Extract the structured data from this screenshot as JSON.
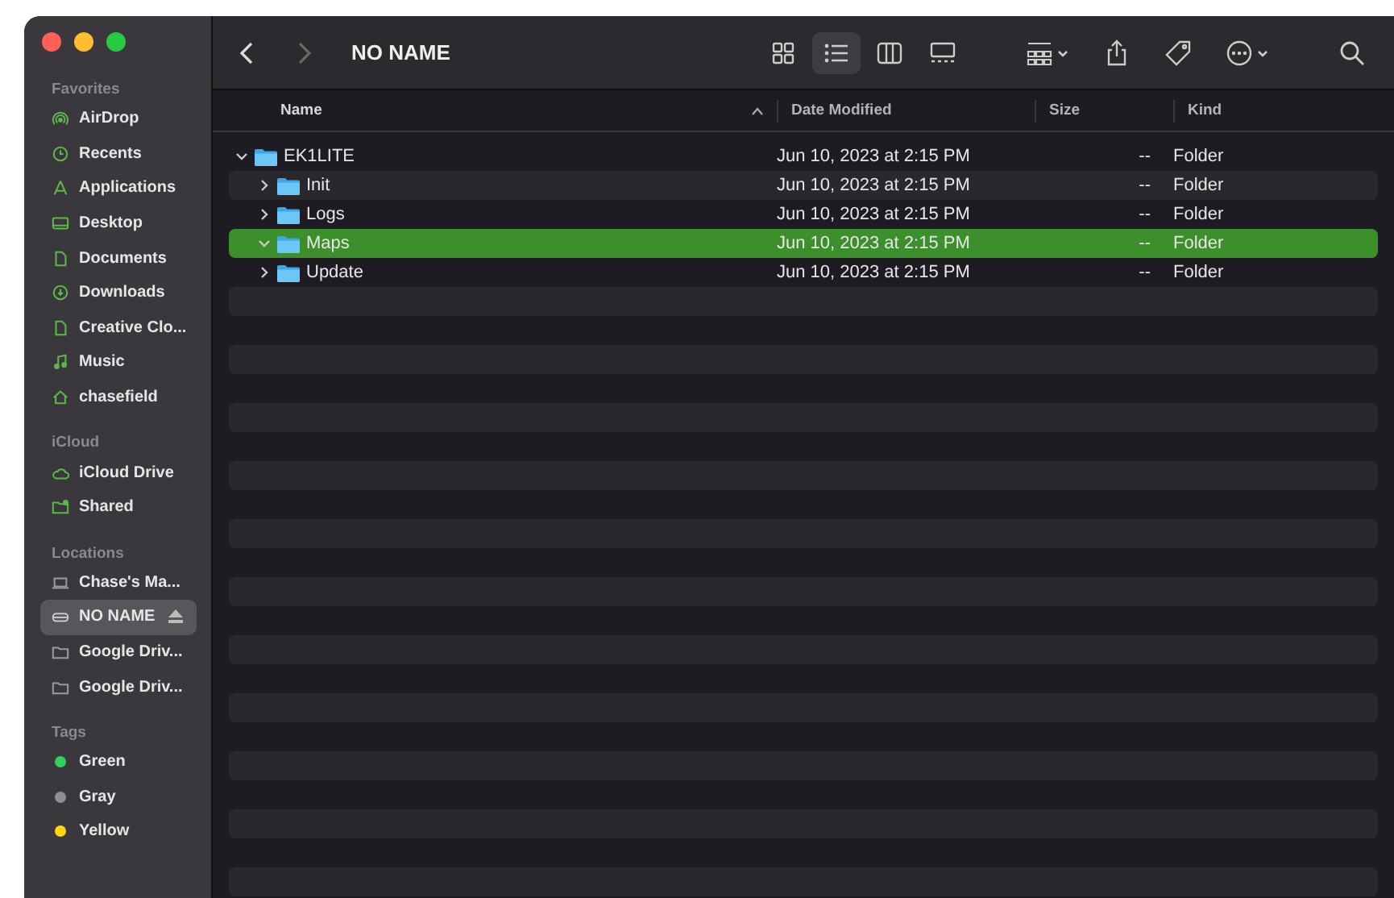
{
  "window": {
    "title": "NO NAME"
  },
  "navigation": {
    "back_enabled": true,
    "forward_enabled": false
  },
  "view_modes": [
    {
      "selected": false
    },
    {
      "selected": true
    },
    {
      "selected": false
    },
    {
      "selected": false
    }
  ],
  "sidebar": {
    "sections": [
      {
        "title": "Favorites",
        "items": [
          {
            "label": "AirDrop",
            "selected": false
          },
          {
            "label": "Recents",
            "selected": false
          },
          {
            "label": "Applications",
            "selected": false
          },
          {
            "label": "Desktop",
            "selected": false
          },
          {
            "label": "Documents",
            "selected": false
          },
          {
            "label": "Downloads",
            "selected": false
          },
          {
            "label": "Creative Clo...",
            "selected": false
          },
          {
            "label": "Music",
            "selected": false
          },
          {
            "label": "chasefield",
            "selected": false
          }
        ]
      },
      {
        "title": "iCloud",
        "items": [
          {
            "label": "iCloud Drive",
            "selected": false
          },
          {
            "label": "Shared",
            "selected": false
          }
        ]
      },
      {
        "title": "Locations",
        "items": [
          {
            "label": "Chase's Ma...",
            "selected": false
          },
          {
            "label": "NO NAME",
            "selected": true,
            "ejectable": true
          },
          {
            "label": "Google Driv...",
            "selected": false
          },
          {
            "label": "Google Driv...",
            "selected": false
          }
        ]
      },
      {
        "title": "Tags",
        "items": [
          {
            "label": "Green",
            "selected": false,
            "color": "#30d158"
          },
          {
            "label": "Gray",
            "selected": false,
            "color": "#8e8e93"
          },
          {
            "label": "Yellow",
            "selected": false,
            "color": "#ffd60a"
          }
        ]
      }
    ]
  },
  "table": {
    "columns": [
      {
        "label": "Name",
        "sorted": true
      },
      {
        "label": "Date Modified",
        "sorted": false
      },
      {
        "label": "Size",
        "sorted": false
      },
      {
        "label": "Kind",
        "sorted": false
      }
    ],
    "rows": [
      {
        "name": "EK1LITE",
        "date": "Jun 10, 2023 at 2:15 PM",
        "size": "--",
        "kind": "Folder",
        "expanded": true,
        "selected": false,
        "children": [
          {
            "name": "Init",
            "date": "Jun 10, 2023 at 2:15 PM",
            "size": "--",
            "kind": "Folder",
            "expanded": false,
            "selected": false
          },
          {
            "name": "Logs",
            "date": "Jun 10, 2023 at 2:15 PM",
            "size": "--",
            "kind": "Folder",
            "expanded": false,
            "selected": false
          },
          {
            "name": "Maps",
            "date": "Jun 10, 2023 at 2:15 PM",
            "size": "--",
            "kind": "Folder",
            "expanded": true,
            "selected": true
          },
          {
            "name": "Update",
            "date": "Jun 10, 2023 at 2:15 PM",
            "size": "--",
            "kind": "Folder",
            "expanded": false,
            "selected": false
          }
        ]
      }
    ]
  }
}
